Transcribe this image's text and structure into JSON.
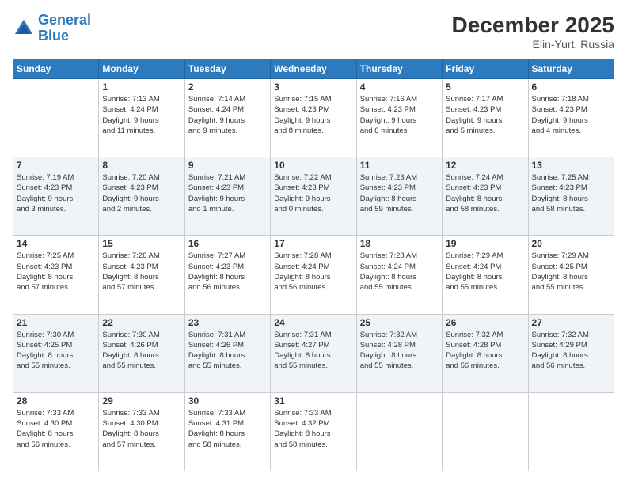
{
  "header": {
    "logo_line1": "General",
    "logo_line2": "Blue",
    "month": "December 2025",
    "location": "Elin-Yurt, Russia"
  },
  "days_of_week": [
    "Sunday",
    "Monday",
    "Tuesday",
    "Wednesday",
    "Thursday",
    "Friday",
    "Saturday"
  ],
  "weeks": [
    [
      {
        "day": "",
        "info": ""
      },
      {
        "day": "1",
        "info": "Sunrise: 7:13 AM\nSunset: 4:24 PM\nDaylight: 9 hours\nand 11 minutes."
      },
      {
        "day": "2",
        "info": "Sunrise: 7:14 AM\nSunset: 4:24 PM\nDaylight: 9 hours\nand 9 minutes."
      },
      {
        "day": "3",
        "info": "Sunrise: 7:15 AM\nSunset: 4:23 PM\nDaylight: 9 hours\nand 8 minutes."
      },
      {
        "day": "4",
        "info": "Sunrise: 7:16 AM\nSunset: 4:23 PM\nDaylight: 9 hours\nand 6 minutes."
      },
      {
        "day": "5",
        "info": "Sunrise: 7:17 AM\nSunset: 4:23 PM\nDaylight: 9 hours\nand 5 minutes."
      },
      {
        "day": "6",
        "info": "Sunrise: 7:18 AM\nSunset: 4:23 PM\nDaylight: 9 hours\nand 4 minutes."
      }
    ],
    [
      {
        "day": "7",
        "info": "Sunrise: 7:19 AM\nSunset: 4:23 PM\nDaylight: 9 hours\nand 3 minutes."
      },
      {
        "day": "8",
        "info": "Sunrise: 7:20 AM\nSunset: 4:23 PM\nDaylight: 9 hours\nand 2 minutes."
      },
      {
        "day": "9",
        "info": "Sunrise: 7:21 AM\nSunset: 4:23 PM\nDaylight: 9 hours\nand 1 minute."
      },
      {
        "day": "10",
        "info": "Sunrise: 7:22 AM\nSunset: 4:23 PM\nDaylight: 9 hours\nand 0 minutes."
      },
      {
        "day": "11",
        "info": "Sunrise: 7:23 AM\nSunset: 4:23 PM\nDaylight: 8 hours\nand 59 minutes."
      },
      {
        "day": "12",
        "info": "Sunrise: 7:24 AM\nSunset: 4:23 PM\nDaylight: 8 hours\nand 58 minutes."
      },
      {
        "day": "13",
        "info": "Sunrise: 7:25 AM\nSunset: 4:23 PM\nDaylight: 8 hours\nand 58 minutes."
      }
    ],
    [
      {
        "day": "14",
        "info": "Sunrise: 7:25 AM\nSunset: 4:23 PM\nDaylight: 8 hours\nand 57 minutes."
      },
      {
        "day": "15",
        "info": "Sunrise: 7:26 AM\nSunset: 4:23 PM\nDaylight: 8 hours\nand 57 minutes."
      },
      {
        "day": "16",
        "info": "Sunrise: 7:27 AM\nSunset: 4:23 PM\nDaylight: 8 hours\nand 56 minutes."
      },
      {
        "day": "17",
        "info": "Sunrise: 7:28 AM\nSunset: 4:24 PM\nDaylight: 8 hours\nand 56 minutes."
      },
      {
        "day": "18",
        "info": "Sunrise: 7:28 AM\nSunset: 4:24 PM\nDaylight: 8 hours\nand 55 minutes."
      },
      {
        "day": "19",
        "info": "Sunrise: 7:29 AM\nSunset: 4:24 PM\nDaylight: 8 hours\nand 55 minutes."
      },
      {
        "day": "20",
        "info": "Sunrise: 7:29 AM\nSunset: 4:25 PM\nDaylight: 8 hours\nand 55 minutes."
      }
    ],
    [
      {
        "day": "21",
        "info": "Sunrise: 7:30 AM\nSunset: 4:25 PM\nDaylight: 8 hours\nand 55 minutes."
      },
      {
        "day": "22",
        "info": "Sunrise: 7:30 AM\nSunset: 4:26 PM\nDaylight: 8 hours\nand 55 minutes."
      },
      {
        "day": "23",
        "info": "Sunrise: 7:31 AM\nSunset: 4:26 PM\nDaylight: 8 hours\nand 55 minutes."
      },
      {
        "day": "24",
        "info": "Sunrise: 7:31 AM\nSunset: 4:27 PM\nDaylight: 8 hours\nand 55 minutes."
      },
      {
        "day": "25",
        "info": "Sunrise: 7:32 AM\nSunset: 4:28 PM\nDaylight: 8 hours\nand 55 minutes."
      },
      {
        "day": "26",
        "info": "Sunrise: 7:32 AM\nSunset: 4:28 PM\nDaylight: 8 hours\nand 56 minutes."
      },
      {
        "day": "27",
        "info": "Sunrise: 7:32 AM\nSunset: 4:29 PM\nDaylight: 8 hours\nand 56 minutes."
      }
    ],
    [
      {
        "day": "28",
        "info": "Sunrise: 7:33 AM\nSunset: 4:30 PM\nDaylight: 8 hours\nand 56 minutes."
      },
      {
        "day": "29",
        "info": "Sunrise: 7:33 AM\nSunset: 4:30 PM\nDaylight: 8 hours\nand 57 minutes."
      },
      {
        "day": "30",
        "info": "Sunrise: 7:33 AM\nSunset: 4:31 PM\nDaylight: 8 hours\nand 58 minutes."
      },
      {
        "day": "31",
        "info": "Sunrise: 7:33 AM\nSunset: 4:32 PM\nDaylight: 8 hours\nand 58 minutes."
      },
      {
        "day": "",
        "info": ""
      },
      {
        "day": "",
        "info": ""
      },
      {
        "day": "",
        "info": ""
      }
    ]
  ]
}
